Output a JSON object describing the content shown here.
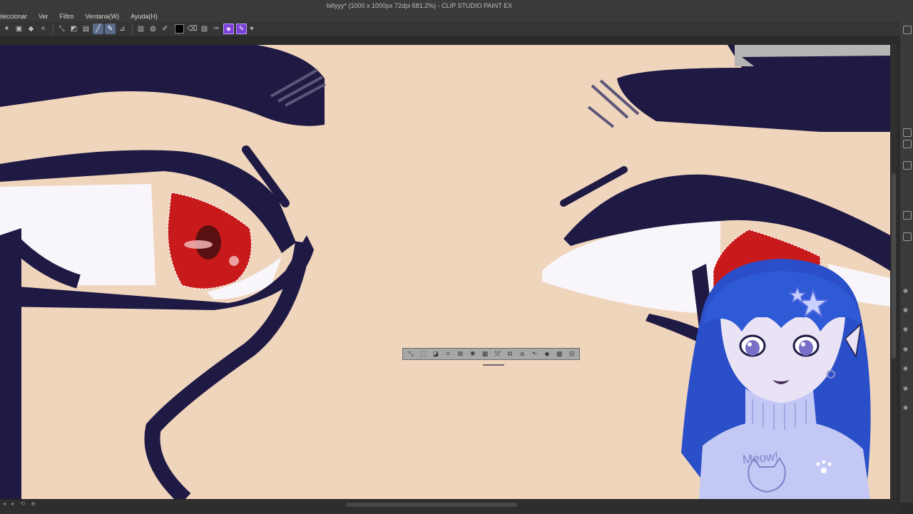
{
  "app": {
    "window_title": "billyyy* (1000 x 1000px 72dpi 681.2%) - CLIP STUDIO PAINT EX"
  },
  "menu": {
    "items": [
      "eleccionar",
      "Ver",
      "Filtro",
      "Ventana(W)",
      "Ayuda(H)"
    ]
  },
  "toolbar": {
    "icons": [
      "selection-icon",
      "layer-icon",
      "fill-icon",
      "transform-icon",
      "deselect-icon",
      "invert-icon",
      "select-color-icon",
      "active-tool-icon",
      "pen-icon",
      "ruler-icon",
      "doc-icon",
      "layer-property-icon",
      "pencil-icon",
      "black-color-swatch",
      "eraser-icon",
      "mask-icon",
      "eyedropper-icon",
      "texture-icon",
      "purple-fill-icon"
    ],
    "color_main": "#000000",
    "color_accent": "#7b3fd6"
  },
  "selection_launcher": {
    "icons": [
      "deselect-icon",
      "select-all-icon",
      "invert-selection-icon",
      "crop-icon",
      "clear-icon",
      "expand-icon",
      "shrink-icon",
      "fill-icon",
      "copy-paste-icon",
      "transform-icon",
      "select-mode-icon",
      "settings-icon",
      "flip-icon",
      "dither-icon"
    ]
  },
  "canvas": {
    "skin_color": "#f0d5bd",
    "line_color": "#1f1a44",
    "iris_color": "#c8191b",
    "white_color": "#f8f6fa",
    "zoom": "681.2%"
  },
  "avatar": {
    "sweater_text": "Meow!",
    "hair_color": "#2a4fc8",
    "skin_color": "#e9e3f5"
  }
}
